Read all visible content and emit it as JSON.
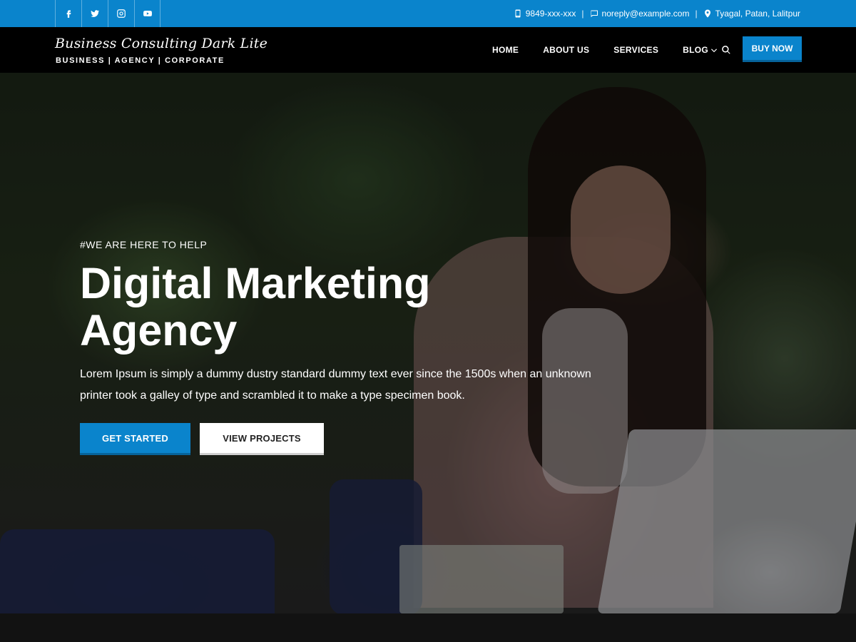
{
  "topbar": {
    "social": [
      {
        "name": "facebook-icon"
      },
      {
        "name": "twitter-icon"
      },
      {
        "name": "instagram-icon"
      },
      {
        "name": "youtube-icon"
      }
    ],
    "phone": "9849-xxx-xxx",
    "email": "noreply@example.com",
    "address": "Tyagal, Patan, Lalitpur",
    "separator": "|"
  },
  "header": {
    "site_title": "Business Consulting Dark Lite",
    "tagline": "BUSINESS | AGENCY | CORPORATE",
    "nav": [
      "HOME",
      "ABOUT US",
      "SERVICES",
      "BLOG"
    ],
    "buy_label": "BUY NOW"
  },
  "hero": {
    "eyebrow": "#WE ARE HERE TO HELP",
    "headline": "Digital Marketing Agency",
    "description": "Lorem Ipsum is simply a dummy dustry standard dummy text ever since the 1500s when an unknown printer took a galley of type and scrambled it to make a type specimen book.",
    "primary_label": "GET STARTED",
    "secondary_label": "VIEW PROJECTS"
  },
  "colors": {
    "accent": "#0a84cc",
    "header_bg": "#000000",
    "page_bg": "#121212"
  }
}
